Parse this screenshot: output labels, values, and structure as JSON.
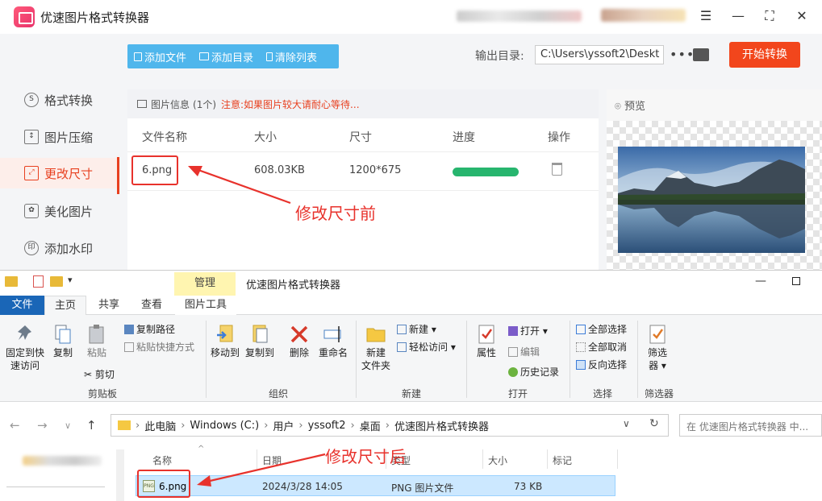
{
  "app": {
    "title": "优速图片格式转换器",
    "sidebar": [
      {
        "label": "格式转换",
        "icon": "format-convert-icon"
      },
      {
        "label": "图片压缩",
        "icon": "compress-icon"
      },
      {
        "label": "更改尺寸",
        "icon": "resize-icon",
        "active": true
      },
      {
        "label": "美化图片",
        "icon": "beautify-icon"
      },
      {
        "label": "添加水印",
        "icon": "watermark-icon"
      }
    ],
    "toolbar": {
      "add_file": "添加文件",
      "add_dir": "添加目录",
      "clear_list": "清除列表"
    },
    "output_label": "输出目录:",
    "output_path": "C:\\Users\\yssoft2\\Deskt",
    "more": "•••",
    "start_button": "开始转换",
    "info": {
      "title": "图片信息",
      "count": "(1个)",
      "warning": "注意:如果图片较大请耐心等待..."
    },
    "table": {
      "headers": [
        "文件名称",
        "大小",
        "尺寸",
        "进度",
        "操作"
      ],
      "row": {
        "name": "6.png",
        "size": "608.03KB",
        "dimensions": "1200*675",
        "progress": 1.0
      }
    },
    "preview_label": "预览",
    "annotation_before": "修改尺寸前",
    "colors": {
      "accent": "#f2461c",
      "toolbar": "#4fb6ec",
      "progress": "#27b56e",
      "annotation": "#e8322c"
    }
  },
  "explorer": {
    "title": "优速图片格式转换器",
    "manage_tab": "管理",
    "tabs": [
      "文件",
      "主页",
      "共享",
      "查看",
      "图片工具"
    ],
    "ribbon": {
      "pin": "固定到快\n速访问",
      "copy": "复制",
      "paste": "粘贴",
      "copy_path": "复制路径",
      "paste_shortcut": "粘贴快捷方式",
      "cut": "剪切",
      "group_clipboard": "剪贴板",
      "move_to": "移动到",
      "copy_to": "复制到",
      "delete": "删除",
      "rename": "重命名",
      "group_organize": "组织",
      "new_folder": "新建\n文件夹",
      "new_item": "新建",
      "easy_access": "轻松访问",
      "group_new": "新建",
      "properties": "属性",
      "open": "打开",
      "edit": "编辑",
      "history": "历史记录",
      "group_open": "打开",
      "select_all": "全部选择",
      "select_none": "全部取消",
      "invert_selection": "反向选择",
      "group_select": "选择",
      "filter": "筛选\n器",
      "group_filter": "筛选器"
    },
    "breadcrumb": [
      "此电脑",
      "Windows (C:)",
      "用户",
      "yssoft2",
      "桌面",
      "优速图片格式转换器"
    ],
    "search_placeholder": "在 优速图片格式转换器 中...",
    "columns": [
      "名称",
      "日期",
      "类型",
      "大小",
      "标记"
    ],
    "file": {
      "name": "6.png",
      "date": "2024/3/28 14:05",
      "type": "PNG 图片文件",
      "size": "73 KB"
    },
    "annotation_after": "修改尺寸后"
  }
}
